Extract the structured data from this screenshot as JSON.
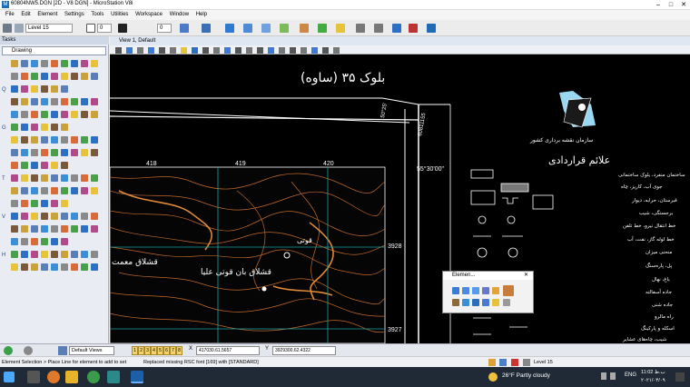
{
  "window": {
    "title": "60804NW5.DGN [2D - V8 DGN] - MicroStation V8i",
    "minimize_icon": "minimize-icon",
    "maximize_icon": "maximize-icon",
    "close_icon": "close-icon"
  },
  "menu": [
    "File",
    "Edit",
    "Element",
    "Settings",
    "Tools",
    "Utilities",
    "Workspace",
    "Window",
    "Help"
  ],
  "toolbar": {
    "level": "Level 15",
    "color": "0",
    "weight": "0"
  },
  "tasks": {
    "title": "Tasks",
    "dropdown": "Drawing",
    "section_labels": [
      "Q",
      "G",
      "T",
      "V",
      "H"
    ]
  },
  "view": {
    "title": "View 1, Default",
    "map": {
      "block_title": "بلوک ۳۵ (ساوه)",
      "grid_top": [
        "418",
        "419",
        "420"
      ],
      "grid_right": [
        "3928",
        "3927"
      ],
      "corner_a": "50°25'",
      "corner_b": "55°30'00\"",
      "corner_c": "60811155",
      "org_name": "سازمان نقشه برداری کشور",
      "legend_title": "علائم قراردادی",
      "places": [
        "قشلاق معمت",
        "قشلاق بان قوتی علیا",
        "قوتی"
      ],
      "legend_items": [
        "ساختمان منفرد، بلوک ساختمانی",
        "جوی آب، کاریز، چاه",
        "قبرستان، حرابه، دیوار",
        "برجستگی، شیب",
        "خط انتقال نیرو، خط تلفن",
        "خط لوله گاز، نفت، آب",
        "منحنی میزان",
        "پل، پاره‌سنگ",
        "باغ، نهال",
        "جاده آسفالته",
        "جاده شنی",
        "راه مالرو",
        "اسکله و پارکینگ",
        "شیب، چاه‌های عشایر"
      ]
    }
  },
  "element_dialog": {
    "title": "Elemen..."
  },
  "viewbar": {
    "views": "Default Views",
    "views_numbers": [
      "1",
      "2",
      "3",
      "4",
      "5",
      "6",
      "7",
      "8"
    ],
    "x_label": "X",
    "x_value": "417030.61.5657",
    "y_label": "Y",
    "y_value": "3929300.62.4322"
  },
  "statusbar": {
    "left": "Element Selection > Place Line for element to add to set",
    "middle": "Replaced missing RSC font [169] with [STANDARD]",
    "level": "Level 15"
  },
  "taskbar": {
    "weather": "26°F  Partly cloudy",
    "lang": "ENG",
    "time": "11:02 ب.ظ",
    "date": "۲۰۲۱/۰۳/۰۹"
  },
  "colors": {
    "contour": "#c06a2a",
    "grid": "#1aa3a3",
    "map_bg": "#000000"
  }
}
